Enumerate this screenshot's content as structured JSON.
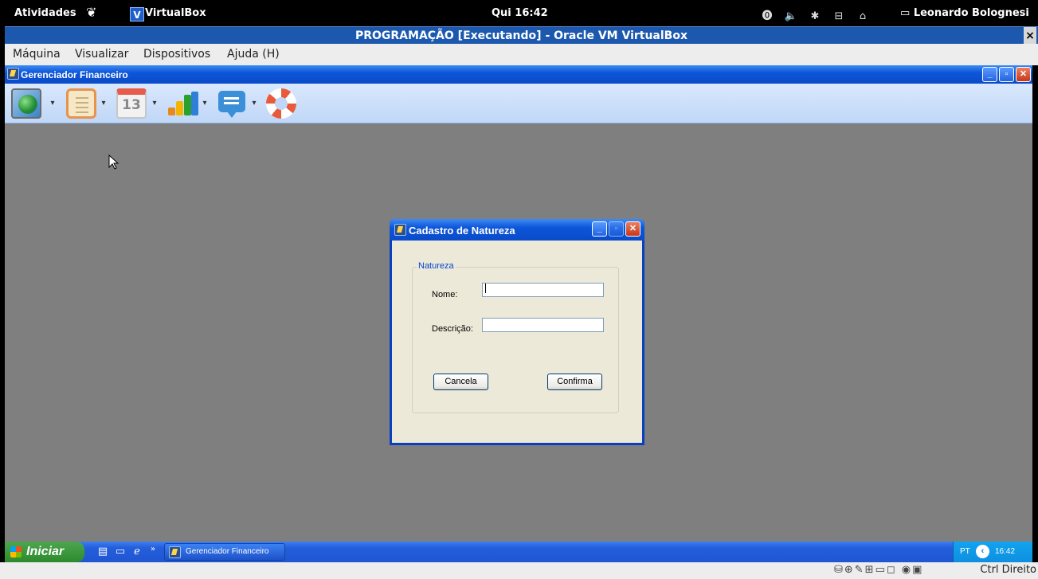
{
  "gnome_bar": {
    "activities": "Atividades",
    "app_name": "VirtualBox",
    "app_logo_letter": "V",
    "clock": "Qui 16:42",
    "tray": [
      "accessibility-icon",
      "volume-icon",
      "bluetooth-icon",
      "network-icon",
      "battery-icon"
    ],
    "tray_glyphs": [
      "⓿",
      "🔈",
      "✱",
      "⊟",
      "⌂"
    ],
    "user_name": "Leonardo Bolognesi"
  },
  "vbox_window": {
    "title": "PROGRAMAÇÃO [Executando] - Oracle VM VirtualBox",
    "close_glyph": "×",
    "menu": [
      {
        "label": "Máquina"
      },
      {
        "label": "Visualizar"
      },
      {
        "label": "Dispositivos"
      },
      {
        "label": "Ajuda (H)"
      }
    ],
    "status_icons": "⛁⊕✎⊞▭◻ ◉▣",
    "host_key": "Ctrl Direito"
  },
  "app": {
    "title": "Gerenciador Financeiro",
    "window_buttons": {
      "minimize": "_",
      "maximize": "▫",
      "close": "✕"
    },
    "toolbar": {
      "calendar_day": "13",
      "dropdown_glyph": "▾",
      "chart_colors": [
        "#e8891e",
        "#f2b600",
        "#2ca02c",
        "#2f7ed8"
      ]
    }
  },
  "dialog": {
    "title": "Cadastro de Natureza",
    "group_label": "Natureza",
    "name_label": "Nome:",
    "name_value": "",
    "description_label": "Descrição:",
    "description_value": "",
    "cancel_label": "Cancela",
    "confirm_label": "Confirma"
  },
  "taskbar": {
    "start_label": "Iniciar",
    "quick_launch": [
      "▤",
      "▭",
      "ℯ",
      "»"
    ],
    "task_label": "Gerenciador Financeiro",
    "language": "PT",
    "tray_arrow": "‹",
    "time": "16:42"
  }
}
